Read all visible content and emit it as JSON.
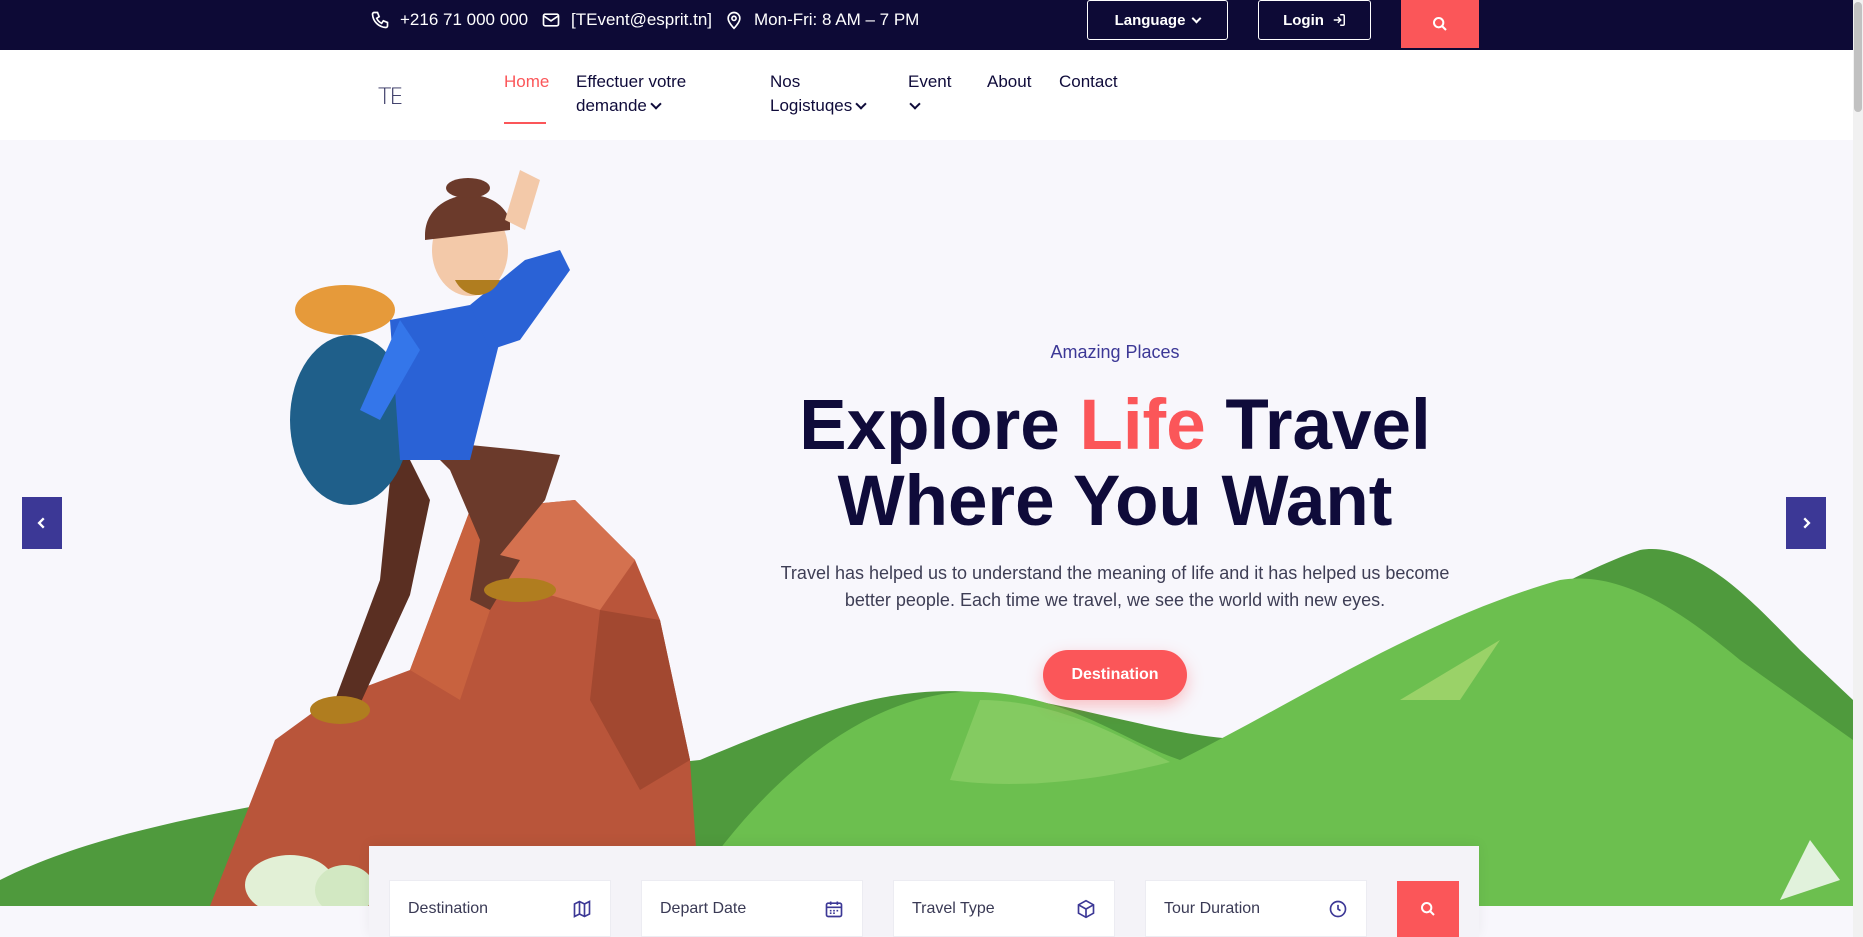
{
  "topbar": {
    "phone": "+216 71 000 000",
    "email": "[TEvent@esprit.tn]",
    "hours": "Mon-Fri: 8 AM – 7 PM",
    "language_label": "Language",
    "login_label": "Login",
    "icons": [
      "phone-icon",
      "mail-icon",
      "location-pin-icon",
      "chevron-down-icon",
      "login-icon",
      "search-icon"
    ]
  },
  "nav": {
    "logo": "TE",
    "items": [
      {
        "label": "Home",
        "active": true
      },
      {
        "label": "Effectuer votre",
        "label2": "demande"
      },
      {
        "label": "Nos",
        "label2": "Logistuqes"
      },
      {
        "label": "Event"
      },
      {
        "label": "About"
      },
      {
        "label": "Contact"
      }
    ]
  },
  "hero": {
    "subtitle": "Amazing Places",
    "headline_part1": "Explore ",
    "headline_highlight": "Life",
    "headline_part2": " Travel",
    "headline_line2": "Where You Want",
    "description": "Travel has helped us to understand the meaning of life and it has helped us become better people. Each time we travel, we see the world with new eyes.",
    "cta_label": "Destination"
  },
  "search_form": {
    "fields": [
      {
        "label": "Destination",
        "icon": "map-icon"
      },
      {
        "label": "Depart Date",
        "icon": "calendar-icon"
      },
      {
        "label": "Travel Type",
        "icon": "box-icon"
      },
      {
        "label": "Tour Duration",
        "icon": "clock-icon"
      }
    ]
  },
  "colors": {
    "navy": "#0d0a36",
    "accent": "#fb5659",
    "indigo": "#3c3896"
  }
}
